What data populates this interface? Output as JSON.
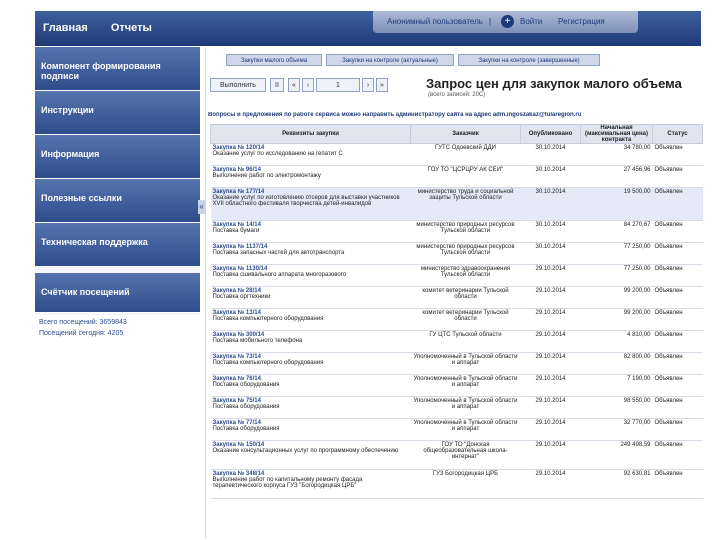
{
  "nav": {
    "home": "Главная",
    "reports": "Отчеты"
  },
  "userbar": {
    "user": "Анонимный пользователь",
    "separator": "|",
    "plus": "+",
    "login": "Войти",
    "register": "Регистрация"
  },
  "sidebar": {
    "items": [
      "Компонент формирования подписи",
      "Инструкции",
      "Информация",
      "Полезные ссылки",
      "Техническая поддержка",
      "Счётчик посещений"
    ],
    "counter": {
      "total": "Всего посещений: 3659843",
      "today": "Посещений сегодня: 4205"
    }
  },
  "collapse": "«",
  "tabs": [
    "Закупки малого объема",
    "Закупки на контроле (актуальные)",
    "Закупки на контроле (завершенные)"
  ],
  "toolbar": {
    "execute": "Выполнить",
    "pause": "II",
    "first": "«",
    "prev": "‹",
    "page": "1",
    "next": "›",
    "last": "»"
  },
  "page": {
    "title": "Запрос цен для закупок малого объема",
    "count": "(всего записей: 20С)",
    "notice": "Вопросы и предложения по работе сервиса можно направить администратору сайта на адрес adm.ingoszakaz@tularegion.ru"
  },
  "table": {
    "headers": [
      "Реквизиты закупки",
      "Заказчик",
      "Опубликовано",
      "Начальная (максимальная цена) контракта",
      "Статус"
    ],
    "rows": [
      {
        "num": "Закупка № 120/14",
        "desc": "Оказание услуг по исследованию на гепатит С",
        "customer": "ГУТС Одоевский ДДИ",
        "date": "30.10.2014",
        "price": "34 780,00",
        "status": "Объявлен"
      },
      {
        "num": "Закупка № 96/14",
        "desc": "Выполнение работ по электромонтажу",
        "customer": "ГОУ ТО \"ЦСРЦРУ АК СЕЙ\"",
        "date": "30.10.2014",
        "price": "27 456,96",
        "status": "Объявлен"
      },
      {
        "num": "Закупка № 177/14",
        "desc": "Оказание услуг по изготовлению отсеров для выставки участников XVII областного фестиваля творчества детей-инвалидов",
        "customer": "министерство труда и социальной защиты Тульской области",
        "date": "30.10.2014",
        "price": "19 500,00",
        "status": "Объявлен"
      },
      {
        "num": "Закупка № 14/14",
        "desc": "Поставка бумаги",
        "customer": "министерство природных ресурсов Тульской области",
        "date": "30.10.2014",
        "price": "84 270,67",
        "status": "Объявлен"
      },
      {
        "num": "Закупка № 1137/14",
        "desc": "Поставка запасных частей для автотранспорта",
        "customer": "министерство природных ресурсов Тульской области",
        "date": "30.10.2014",
        "price": "77 250,00",
        "status": "Объявлен"
      },
      {
        "num": "Закупка № 1130/14",
        "desc": "Поставка сшивального аппарата многоразового",
        "customer": "министерство здравоохранения Тульской области",
        "date": "29.10.2014",
        "price": "77 250,00",
        "status": "Объявлен"
      },
      {
        "num": "Закупка № 28/14",
        "desc": "Поставка оргтехники",
        "customer": "комитет ветеринарии Тульской области",
        "date": "29.10.2014",
        "price": "99 200,00",
        "status": "Объявлен"
      },
      {
        "num": "Закупка № 13/14",
        "desc": "Поставка компьютерного оборудования",
        "customer": "комитет ветеринарии Тульской области",
        "date": "29.10.2014",
        "price": "99 200,00",
        "status": "Объявлен"
      },
      {
        "num": "Закупка № 300/14",
        "desc": "Поставка мобильного телефона",
        "customer": "ГУ ЦТС Тульской области",
        "date": "29.10.2014",
        "price": "4 810,00",
        "status": "Объявлен"
      },
      {
        "num": "Закупка № 73/14",
        "desc": "Поставка компьютерного оборудования",
        "customer": "Уполномоченный в Тульской области и аппарат",
        "date": "29.10.2014",
        "price": "82 800,00",
        "status": "Объявлен"
      },
      {
        "num": "Закупка № 76/14",
        "desc": "Поставка оборудования",
        "customer": "Уполномоченный в Тульской области и аппарат",
        "date": "29.10.2014",
        "price": "7 190,00",
        "status": "Объявлен"
      },
      {
        "num": "Закупка № 75/14",
        "desc": "Поставка оборудования",
        "customer": "Уполномоченный в Тульской области и аппарат",
        "date": "29.10.2014",
        "price": "98 550,00",
        "status": "Объявлен"
      },
      {
        "num": "Закупка № 77/14",
        "desc": "Поставка оборудования",
        "customer": "Уполномоченный в Тульской области и аппарат",
        "date": "29.10.2014",
        "price": "32 770,00",
        "status": "Объявлен"
      },
      {
        "num": "Закупка № 150/14",
        "desc": "Оказание консультационных услуг по программному обеспечению",
        "customer": "ГОУ ТО \"Донская общеобразовательная школа-интернат\"",
        "date": "29.10.2014",
        "price": "249 498,59",
        "status": "Объявлен"
      },
      {
        "num": "Закупка № 348/14",
        "desc": "Выполнение работ по капитальному ремонту фасада терапевтического корпуса ГУЗ \"Богородицкая ЦРБ\"",
        "customer": "ГУЗ Богородицкая ЦРБ",
        "date": "29.10.2014",
        "price": "92 630,81",
        "status": "Объявлен"
      }
    ]
  }
}
